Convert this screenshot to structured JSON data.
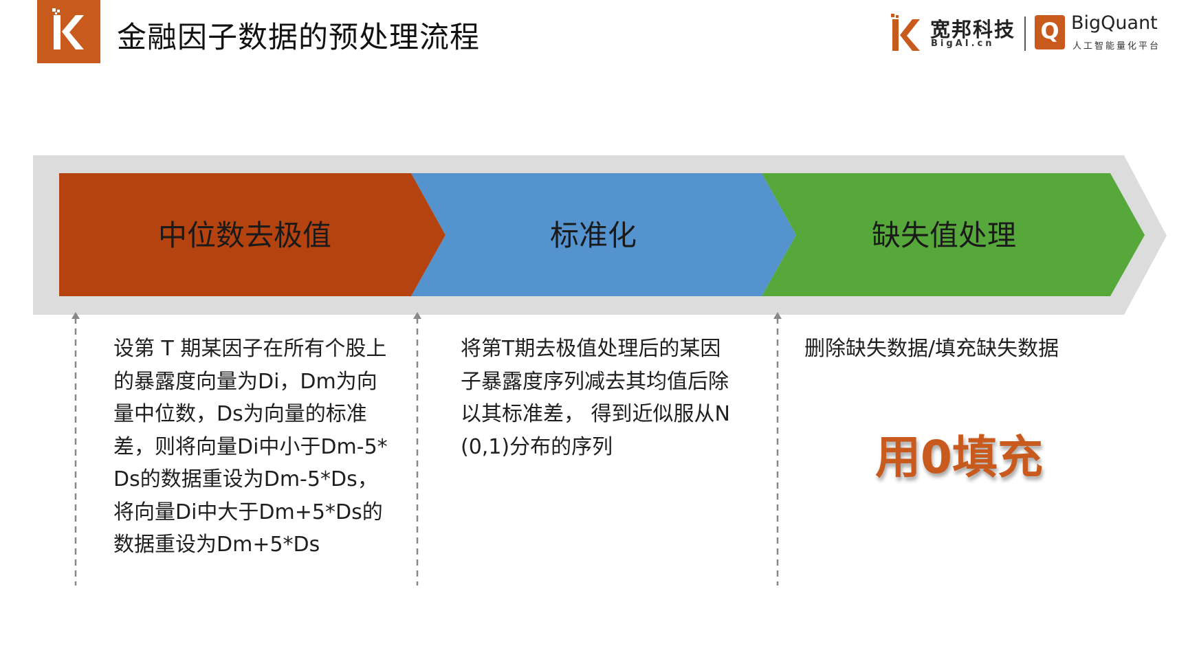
{
  "header": {
    "title": "金融因子数据的预处理流程",
    "logo_letter": "K",
    "brand": {
      "cn_name": "宽邦科技",
      "en_name": "BigAI.cn",
      "product_name": "BigQuant",
      "product_tagline": "人工智能量化平台"
    }
  },
  "colors": {
    "brand_orange": "#c85a1e",
    "stage1": "#b5430f",
    "stage2": "#5593cf",
    "stage3": "#57a83b",
    "outer_arrow": "#dcdcdc",
    "fill_text": "#c85a1e"
  },
  "stages": [
    {
      "label": "中位数去极值"
    },
    {
      "label": "标准化"
    },
    {
      "label": "缺失值处理"
    }
  ],
  "descriptions": [
    "设第 T 期某因子在所有个股上的暴露度向量为Di，Dm为向量中位数，Ds为向量的标准差，则将向量Di中小于Dm-5*Ds的数据重设为Dm-5*Ds，将向量Di中大于Dm+5*Ds的数据重设为Dm+5*Ds",
    "将第T期去极值处理后的某因子暴露度序列减去其均值后除以其标准差， 得到近似服从N(0,1)分布的序列",
    "删除缺失数据/填充缺失数据"
  ],
  "highlight": "用0填充"
}
